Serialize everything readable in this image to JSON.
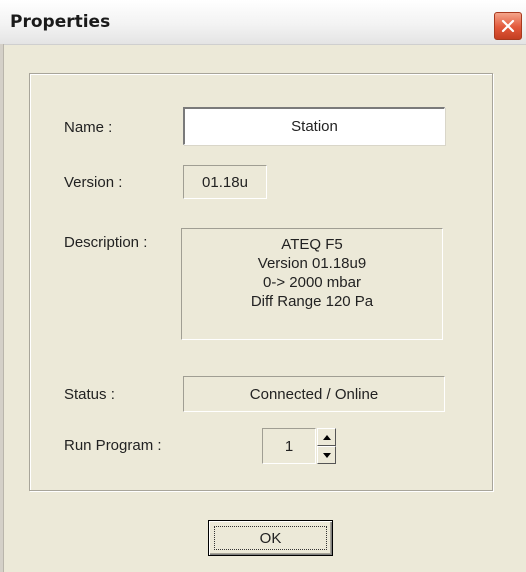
{
  "window": {
    "title": "Properties",
    "close_icon": "close-icon"
  },
  "form": {
    "name_label": "Name :",
    "name_value": "Station",
    "version_label": "Version :",
    "version_value": "01.18u",
    "description_label": "Description :",
    "description_lines": [
      "ATEQ F5",
      "Version  01.18u9",
      "0-> 2000 mbar",
      "Diff Range   120 Pa"
    ],
    "status_label": "Status :",
    "status_value": "Connected / Online",
    "run_program_label": "Run Program :",
    "run_program_value": "1",
    "spin_up_icon": "triangle-up-icon",
    "spin_down_icon": "triangle-down-icon"
  },
  "buttons": {
    "ok_label": "OK"
  },
  "colors": {
    "dialog_background": "#ece9d8",
    "close_button": "#e2583a"
  }
}
